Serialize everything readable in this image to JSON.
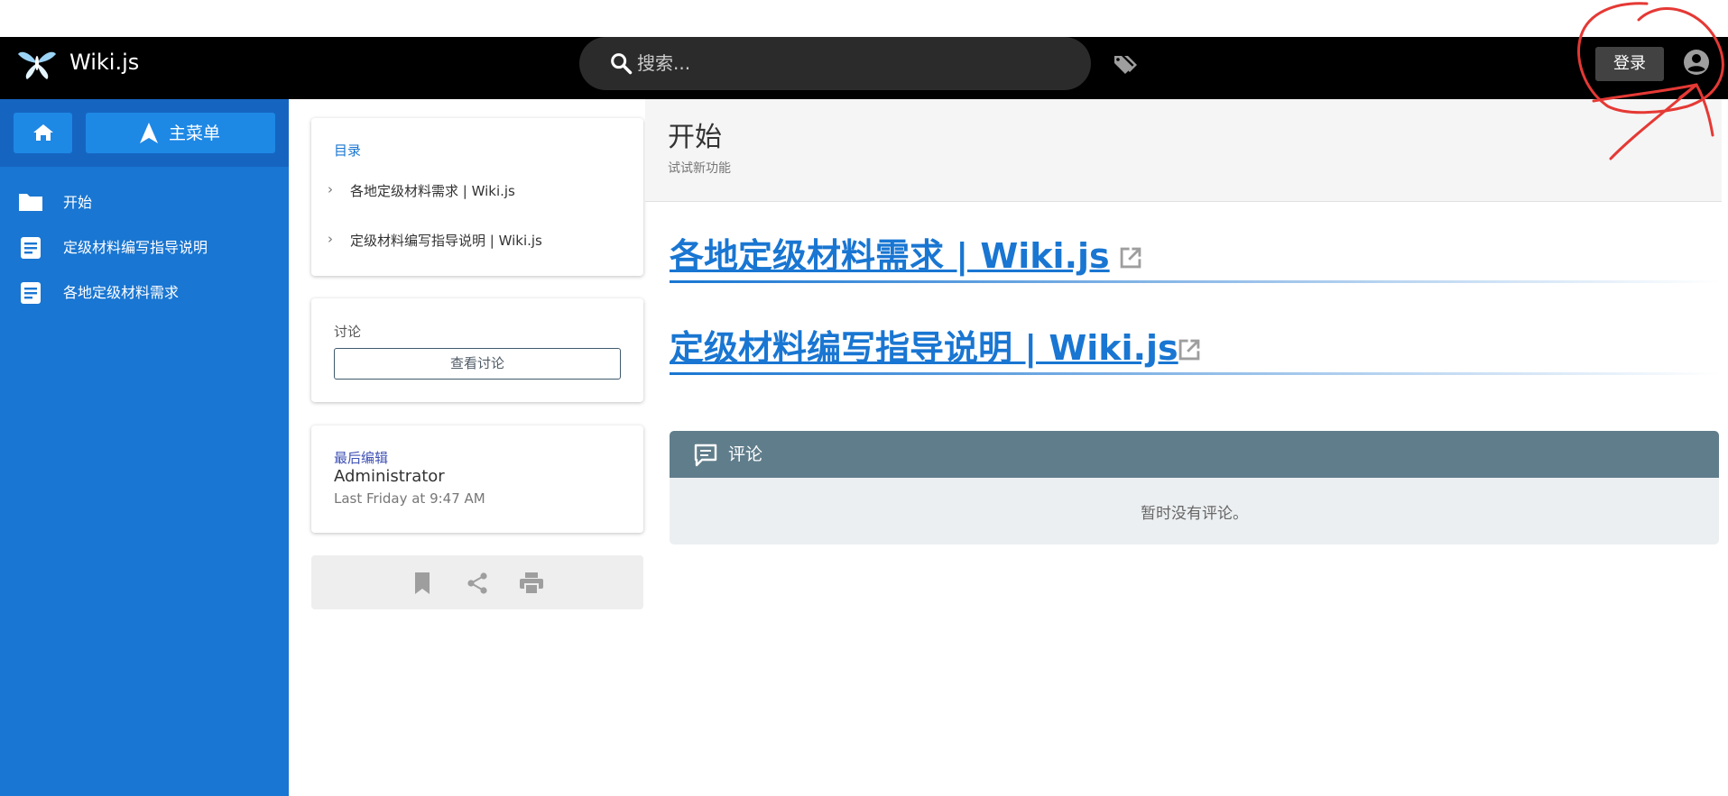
{
  "appbar": {
    "brand": "Wiki.js",
    "search_placeholder": "搜索...",
    "login_label": "登录"
  },
  "sidebar": {
    "menu_label": "主菜单",
    "items": [
      {
        "label": "开始",
        "icon": "folder-icon"
      },
      {
        "label": "定级材料编写指导说明",
        "icon": "document-icon"
      },
      {
        "label": "各地定级材料需求",
        "icon": "document-icon"
      }
    ]
  },
  "toc": {
    "title": "目录",
    "items": [
      "各地定级材料需求 | Wiki.js",
      "定级材料编写指导说明 | Wiki.js"
    ]
  },
  "discussion": {
    "title": "讨论",
    "button_label": "查看讨论"
  },
  "last_edit": {
    "title": "最后编辑",
    "author": "Administrator",
    "date": "Last Friday at 9:47 AM"
  },
  "page": {
    "title": "开始",
    "subtitle": "试试新功能",
    "links": [
      "各地定级材料需求 | Wiki.js",
      "定级材料编写指导说明 | Wiki.js"
    ]
  },
  "comments": {
    "label": "评论",
    "empty_text": "暂时没有评论。"
  },
  "colors": {
    "appbar": "#000000",
    "sidebar": "#1976d2",
    "link": "#1976d2",
    "comments_header": "#607d8b",
    "annotation": "#e53935"
  }
}
